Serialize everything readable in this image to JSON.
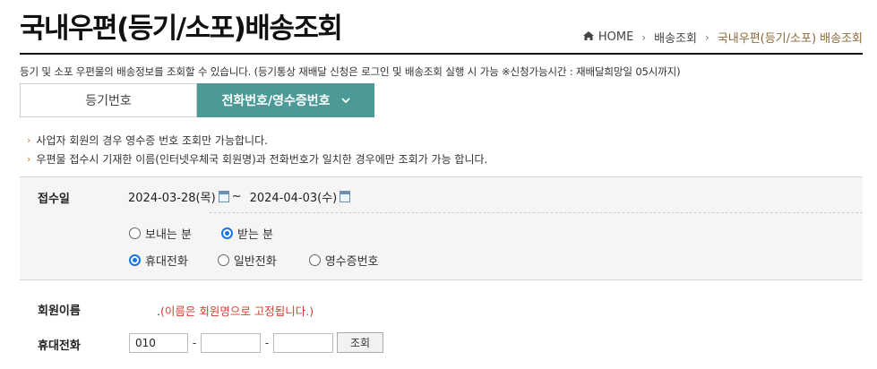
{
  "page": {
    "title": "국내우편(등기/소포)배송조회",
    "description": "등기 및 소포 우편물의 배송정보를 조회할 수 있습니다. (등기통상 재배달 신청은 로그인 및 배송조회 실행 시 가능 ※신청가능시간 : 재배달희망일 05시까지)"
  },
  "breadcrumb": {
    "home": "HOME",
    "level1": "배송조회",
    "current": "국내우편(등기/소포) 배송조회"
  },
  "tabs": [
    {
      "label": "등기번호",
      "active": false
    },
    {
      "label": "전화번호/영수증번호",
      "active": true
    }
  ],
  "notes": [
    "사업자 회원의 경우 영수증 번호 조회만 가능합니다.",
    "우편물 접수시 기재한 이름(인터넷우체국 회원명)과 전화번호가 일치한 경우에만 조회가 가능 합니다."
  ],
  "form": {
    "receipt_date_label": "접수일",
    "date_from": "2024-03-28(목)",
    "date_sep": "~",
    "date_to": "2024-04-03(수)",
    "party_options": [
      {
        "label": "보내는 분",
        "checked": false
      },
      {
        "label": "받는 분",
        "checked": true
      }
    ],
    "type_options": [
      {
        "label": "휴대전화",
        "checked": true
      },
      {
        "label": "일반전화",
        "checked": false
      },
      {
        "label": "영수증번호",
        "checked": false
      }
    ],
    "member_name_label": "회원이름",
    "member_name_prefix": ".",
    "member_name_note": "(이름은 회원명으로 고정됩니다.)",
    "phone_label": "휴대전화",
    "phone1": "010",
    "phone2": "",
    "phone3": "",
    "dash": "-",
    "search_button": "조회"
  },
  "colors": {
    "active_tab": "#4b9a96",
    "accent_arrow": "#e07b39",
    "notice_red": "#d63a2f",
    "radio_checked": "#1a73e8",
    "breadcrumb_current": "#8a6a3a"
  },
  "icons": [
    "home-icon",
    "calendar-icon",
    "chevron-down-icon",
    "bullet-arrow-icon"
  ]
}
